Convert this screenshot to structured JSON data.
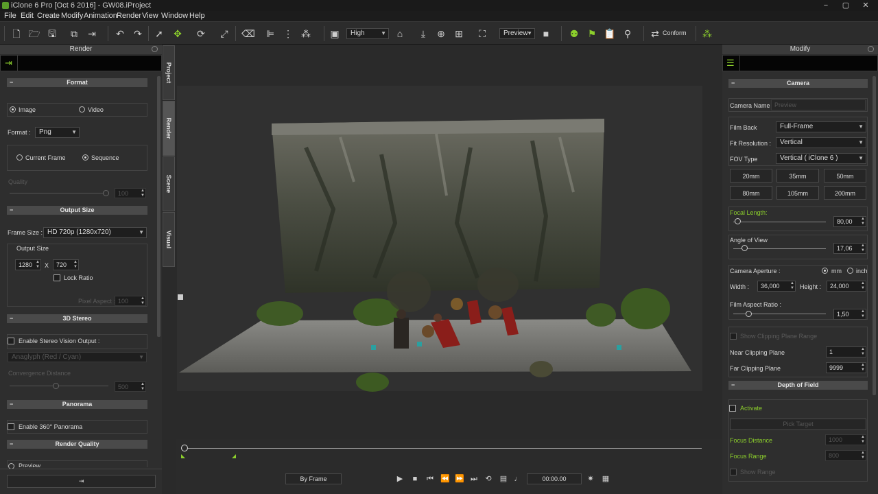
{
  "title": "iClone 6 Pro [Oct  6 2016] - GW08.iProject",
  "window_controls": {
    "minimize": "−",
    "maximize": "▢",
    "close": "✕"
  },
  "menu": [
    "File",
    "Edit",
    "Create",
    "Modify",
    "Animation",
    "Render",
    "View",
    "Window",
    "Help"
  ],
  "toolbar": {
    "quality": "High",
    "viewmode": "Preview",
    "conform": "Conform"
  },
  "left": {
    "title": "Render",
    "format_section": "Format",
    "image": "Image",
    "video": "Video",
    "format_label": "Format :",
    "format_value": "Png",
    "current_frame": "Current Frame",
    "sequence": "Sequence",
    "quality_label": "Quality",
    "quality_value": "100",
    "output_size_section": "Output Size",
    "frame_size_label": "Frame Size :",
    "frame_size_value": "HD 720p (1280x720)",
    "output_size_label": "Output Size",
    "width": "1280",
    "x": "X",
    "height": "720",
    "lock_ratio": "Lock Ratio",
    "pixel_aspect_label": "Pixel Aspect :",
    "pixel_aspect_value": "100",
    "stereo_section": "3D Stereo",
    "stereo_enable": "Enable Stereo Vision Output :",
    "anaglyph": "Anaglyph (Red / Cyan)",
    "convergence": "Convergence Distance",
    "convergence_value": "500",
    "panorama_section": "Panorama",
    "panorama_enable": "Enable 360° Panorama",
    "render_quality_section": "Render Quality",
    "preview": "Preview"
  },
  "tabs": [
    "Project",
    "Render",
    "Scene",
    "Visual"
  ],
  "bottom": {
    "mode": "By Frame",
    "time": "00:00.00"
  },
  "right": {
    "title": "Modify",
    "camera_section": "Camera",
    "camera_name_label": "Camera Name :",
    "camera_name_placeholder": "Preview",
    "film_back_label": "Film Back",
    "film_back_value": "Full-Frame",
    "fit_res_label": "Fit Resolution :",
    "fit_res_value": "Vertical",
    "fov_label": "FOV Type",
    "fov_value": "Vertical ( iClone 6 )",
    "lenses": [
      "20mm",
      "35mm",
      "50mm",
      "80mm",
      "105mm",
      "200mm"
    ],
    "focal_label": "Focal Length:",
    "focal_value": "80,00",
    "aov_label": "Angle of View",
    "aov_value": "17,06",
    "aperture_label": "Camera Aperture :",
    "mm": "mm",
    "inch": "inch",
    "width_label": "Width :",
    "width_value": "36,000",
    "height_label": "Height :",
    "height_value": "24,000",
    "film_aspect_label": "Film Aspect Ratio :",
    "film_aspect_value": "1,50",
    "show_clip": "Show Clipping Plane Range",
    "near_label": "Near Clipping Plane",
    "near_value": "1",
    "far_label": "Far Clipping Plane",
    "far_value": "9999",
    "dof_section": "Depth of Field",
    "activate": "Activate",
    "pick_target": "Pick Target",
    "focus_dist_label": "Focus Distance",
    "focus_dist_value": "1000",
    "focus_range_label": "Focus Range",
    "focus_range_value": "800",
    "show_range": "Show Range"
  },
  "colors": {
    "accent": "#8ccf2c",
    "panel": "#2e2e2e",
    "section": "#4a4a4a"
  }
}
